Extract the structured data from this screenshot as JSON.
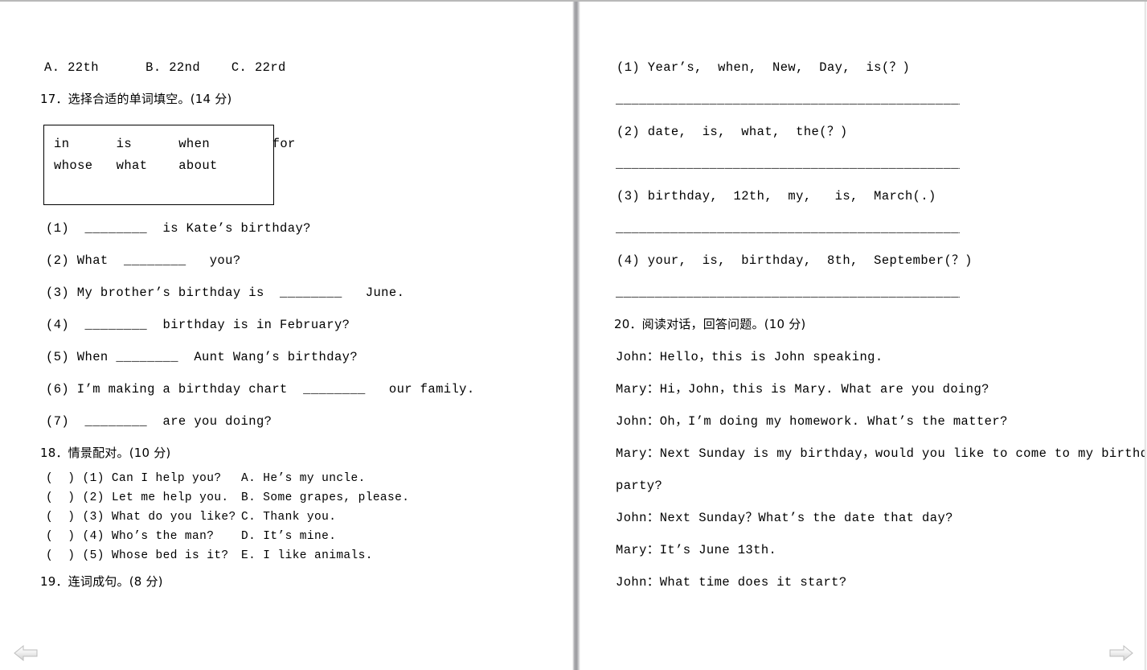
{
  "viewer": {
    "nav": {
      "prev_label": "previous-page",
      "next_label": "next-page"
    }
  },
  "left_page": {
    "choices_line": "A. 22th      B. 22nd    C. 22rd",
    "section17": {
      "heading": "17．选择合适的单词填空。(14 分)",
      "wordbank": {
        "row1": "in      is      when        for",
        "row2": "whose   what    about"
      },
      "items": [
        "(1)  ________  is Kate’s birthday?",
        "(2) What  ________   you?",
        "(3) My brother’s birthday is  ________   June.",
        "(4)  ________  birthday is in February?",
        "(5) When ________  Aunt Wang’s birthday?",
        "(6) I’m making a birthday chart  ________   our family.",
        "(7)  ________  are you doing?"
      ]
    },
    "section18": {
      "heading": "18．情景配对。(10 分)",
      "left_items": [
        "(  ) (1) Can I help you?",
        "(  ) (2) Let me help you.",
        "(  ) (3) What do you like?",
        "(  ) (4) Who’s the man?",
        "(  ) (5) Whose bed is it?"
      ],
      "right_items": [
        "A. He’s my uncle.",
        "B. Some grapes, please.",
        "C. Thank you.",
        "D. It’s mine.",
        "E. I like animals."
      ]
    },
    "section19": {
      "heading": "19．连词成句。(8 分)"
    }
  },
  "right_page": {
    "section19_items": [
      "(1) Year’s,  when,  New,  Day,  is(？)",
      "(2) date,  is,  what,  the(？)",
      "(3) birthday,  12th,  my,   is,  March(.)",
      "(4) your,  is,  birthday,  8th,  September(？)"
    ],
    "answer_rule": "______________________________________________",
    "section20": {
      "heading": "20．阅读对话，回答问题。(10 分)",
      "dialogue": [
        "John：Hello，this is John speaking.",
        "Mary：Hi，John，this is Mary. What are you doing?",
        "John：Oh，I’m doing my homework. What’s the matter?",
        "Mary：Next Sunday is my birthday，would you like to come to my birthday",
        "party?",
        "John：Next Sunday？What’s the date that day?",
        "Mary：It’s June 13th.",
        "John：What time does it start?"
      ]
    }
  }
}
